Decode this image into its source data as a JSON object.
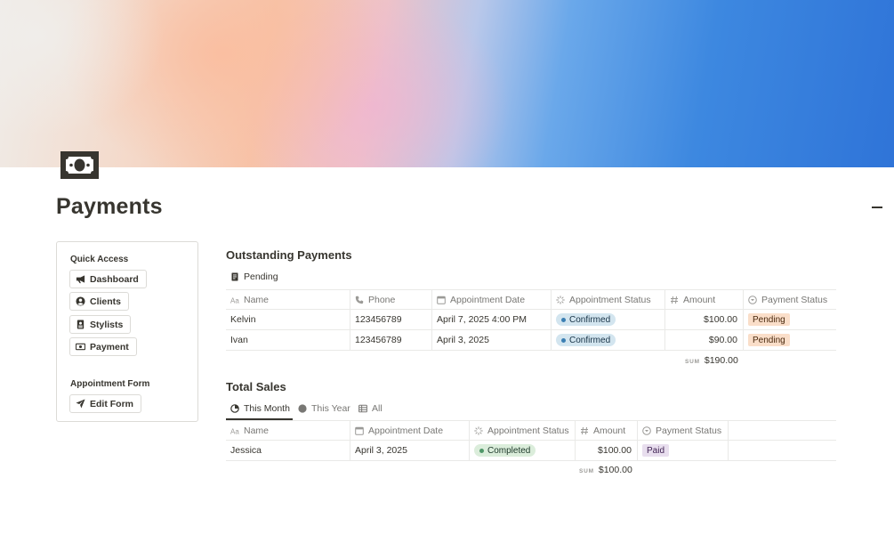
{
  "page": {
    "title": "Payments",
    "icon": "money-bill-icon"
  },
  "sidebar": {
    "quick_access_heading": "Quick Access",
    "items": [
      {
        "label": "Dashboard",
        "icon": "megaphone-icon"
      },
      {
        "label": "Clients",
        "icon": "user-circle-icon"
      },
      {
        "label": "Stylists",
        "icon": "id-badge-icon"
      },
      {
        "label": "Payment",
        "icon": "money-bill-icon"
      }
    ],
    "form_heading": "Appointment Form",
    "form_button": {
      "label": "Edit Form",
      "icon": "paper-plane-icon"
    }
  },
  "outstanding": {
    "title": "Outstanding Payments",
    "view_tab": "Pending",
    "columns": [
      "Name",
      "Phone",
      "Appointment Date",
      "Appointment Status",
      "Amount",
      "Payment Status"
    ],
    "rows": [
      {
        "name": "Kelvin",
        "phone": "123456789",
        "date": "April 7, 2025 4:00 PM",
        "status": "Confirmed",
        "amount": "$100.00",
        "payment": "Pending"
      },
      {
        "name": "Ivan",
        "phone": "123456789",
        "date": "April 3, 2025",
        "status": "Confirmed",
        "amount": "$90.00",
        "payment": "Pending"
      }
    ],
    "sum_label": "SUM",
    "sum_value": "$190.00"
  },
  "sales": {
    "title": "Total Sales",
    "tabs": [
      "This Month",
      "This Year",
      "All"
    ],
    "active_tab": "This Month",
    "columns": [
      "Name",
      "Appointment Date",
      "Appointment Status",
      "Amount",
      "Payment Status"
    ],
    "rows": [
      {
        "name": "Jessica",
        "date": "April 3, 2025",
        "status": "Completed",
        "amount": "$100.00",
        "payment": "Paid"
      }
    ],
    "sum_label": "SUM",
    "sum_value": "$100.00"
  },
  "colors": {
    "text": "#37352f",
    "muted": "#787774",
    "confirmed_bg": "#d3e5ef",
    "completed_bg": "#dbeddb",
    "pending_bg": "#fadec9",
    "paid_bg": "#e8deee"
  }
}
